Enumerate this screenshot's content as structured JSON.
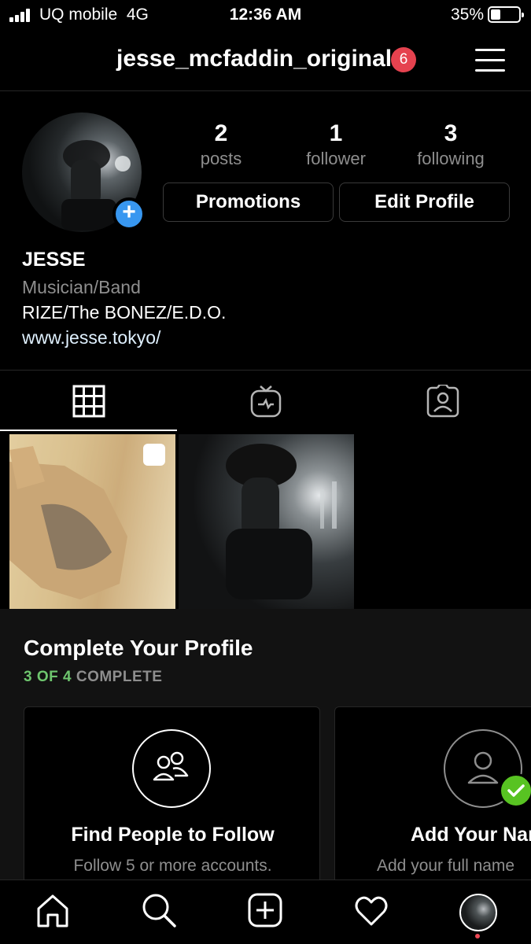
{
  "status_bar": {
    "carrier": "UQ mobile",
    "network": "4G",
    "time": "12:36 AM",
    "battery": "35%",
    "battery_level": 0.35
  },
  "header": {
    "username": "jesse_mcfaddin_original",
    "notification_count": "6"
  },
  "profile": {
    "stats": [
      {
        "value": "2",
        "label": "posts"
      },
      {
        "value": "1",
        "label": "follower"
      },
      {
        "value": "3",
        "label": "following"
      }
    ],
    "promotions_label": "Promotions",
    "edit_profile_label": "Edit Profile",
    "name": "JESSE",
    "category": "Musician/Band",
    "bio": "RIZE/The BONEZ/E.D.O.",
    "website": "www.jesse.tokyo/"
  },
  "tabs": [
    {
      "icon": "grid-icon",
      "active": true
    },
    {
      "icon": "igtv-icon",
      "active": false
    },
    {
      "icon": "tagged-icon",
      "active": false
    }
  ],
  "complete_profile": {
    "title": "Complete Your Profile",
    "progress_done": "3 OF 4",
    "progress_suffix": " COMPLETE",
    "cards": [
      {
        "title": "Find People to Follow",
        "subtitle": "Follow 5 or more accounts.",
        "icon": "people-icon"
      },
      {
        "title": "Add Your Name",
        "subtitle": "Add your full name",
        "icon": "person-icon",
        "completed": true
      }
    ]
  },
  "bottom_nav": [
    "home-icon",
    "search-icon",
    "new-post-icon",
    "activity-heart-icon",
    "profile-avatar"
  ],
  "colors": {
    "accent_blue": "#3897f0",
    "badge_red": "#e5424f",
    "progress_green": "#6ec56e",
    "check_green": "#58c322"
  }
}
